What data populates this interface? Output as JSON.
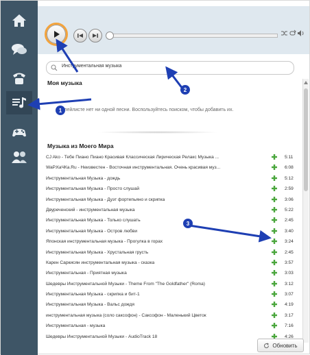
{
  "search": {
    "value": "Инструментальная музыка"
  },
  "sections": {
    "my_music_heading": "Моя музыка",
    "empty_message": "В плейлисте нет ни одной песни. Воспользуйтесь поиском, чтобы добавить их.",
    "world_heading": "Музыка из Моего Мира"
  },
  "tracks": [
    {
      "title": "CJ Ako - Тебе Пиано Пиано Красивая Классическая Лирическая Релакс Музыка ...",
      "duration": "5:11"
    },
    {
      "title": "WaP.КаЧКа.Ru - Неизвестен - Восточная инструментальная. Очень красивая муз...",
      "duration": "6:08"
    },
    {
      "title": "Инструментальная Музыка - дождь",
      "duration": "5:12"
    },
    {
      "title": "Инструментальная Музыка - Просто слушай",
      "duration": "2:59"
    },
    {
      "title": "Инструментальная Музыка - Дуэт фортепьяно и скрипка",
      "duration": "3:06"
    },
    {
      "title": "Двуреченский - инструментальная музыка",
      "duration": "5:22"
    },
    {
      "title": "Инструментальная Музыка - Только слушать",
      "duration": "2:45"
    },
    {
      "title": "Инструментальная Музыка - Остров любви",
      "duration": "3:40"
    },
    {
      "title": "Японская инструментальная музыка - Прогулка в горах",
      "duration": "3:24"
    },
    {
      "title": "Инструментальная Музыка - Хрустальная грусть",
      "duration": "2:45"
    },
    {
      "title": "Карен Саркисян инструментальная музыка - сказка",
      "duration": "3:57"
    },
    {
      "title": "Инструментальная - Приятная музыка",
      "duration": "3:03"
    },
    {
      "title": "Шедевры Инструментальной Музыки - Theme From \"The Goldfather\" (Roma)",
      "duration": "3:12"
    },
    {
      "title": "Инструментальная Музыка - скрипка и бит-1",
      "duration": "3:07"
    },
    {
      "title": "Инструментальная Музыка - Вальс дождя",
      "duration": "4:19"
    },
    {
      "title": "инструментальная музыка (соло саксофон) - Саксофон - Маленький Цветок",
      "duration": "3:17"
    },
    {
      "title": "Инструментальная - музыка",
      "duration": "7:16"
    },
    {
      "title": "Шедевры Инструментальной Музыки - AudioTrack 18",
      "duration": "4:26"
    }
  ],
  "refresh_label": "Обновить",
  "annotations": {
    "m1": "1",
    "m2": "2",
    "m3": "3"
  },
  "colors": {
    "rail": "#3e5566",
    "accent_orange": "#f3a33c",
    "annotation_blue": "#1e3fb3",
    "plus_green": "#4aa63c"
  }
}
